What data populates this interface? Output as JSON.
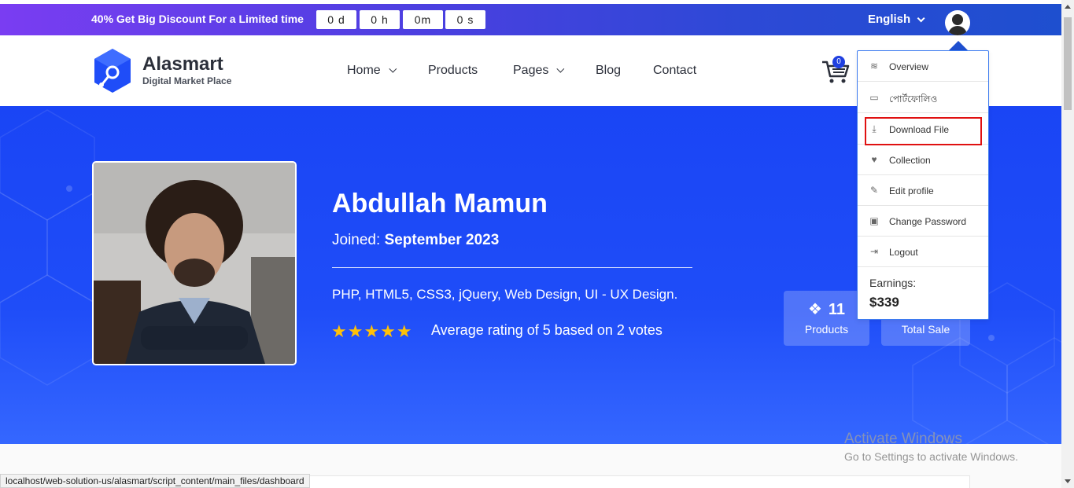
{
  "topbar": {
    "promo_bold": "40%",
    "promo_text": "Get Big Discount For a Limited time",
    "timer": [
      "0 d",
      "0 h",
      "0m",
      "0 s"
    ],
    "language": "English"
  },
  "header": {
    "brand": "Alasmart",
    "tagline": "Digital Market Place",
    "nav": [
      "Home",
      "Products",
      "Pages",
      "Blog",
      "Contact"
    ],
    "cart_count": "0"
  },
  "profile": {
    "name": "Abdullah Mamun",
    "joined_label": "Joined:",
    "joined_date": "September 2023",
    "skills": "PHP, HTML5, CSS3, jQuery, Web Design, UI - UX Design.",
    "stars": "★★★★★",
    "rating_text": "Average rating of 5 based on 2 votes",
    "rating_value": 5,
    "stats": [
      {
        "value": "11",
        "label": "Products"
      },
      {
        "value": "",
        "label": "Total Sale"
      }
    ]
  },
  "dropdown": {
    "items": [
      {
        "icon": "layers-icon",
        "label": "Overview"
      },
      {
        "icon": "portfolio-icon",
        "label": "পোর্টফোলিও"
      },
      {
        "icon": "download-icon",
        "label": "Download File"
      },
      {
        "icon": "heart-icon",
        "label": "Collection"
      },
      {
        "icon": "edit-user-icon",
        "label": "Edit profile"
      },
      {
        "icon": "lock-icon",
        "label": "Change Password"
      },
      {
        "icon": "logout-icon",
        "label": "Logout"
      }
    ],
    "earnings_label": "Earnings:",
    "earnings_value": "$339",
    "highlighted_item": "Download File",
    "highlight_color": "#e01010"
  },
  "os": {
    "watermark_title": "Activate Windows",
    "watermark_sub": "Go to Settings to activate Windows.",
    "status_url": "localhost/web-solution-us/alasmart/script_content/main_files/dashboard"
  },
  "colors": {
    "hero": "#1f4df8",
    "accent": "#1f3fe0",
    "star": "#ffc107"
  }
}
